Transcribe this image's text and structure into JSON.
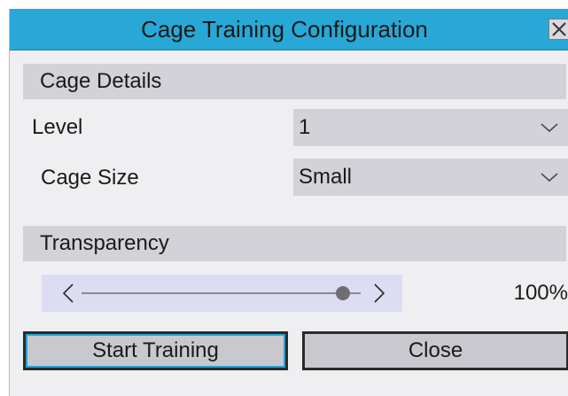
{
  "dialog": {
    "title": "Cage Training Configuration",
    "close_icon": "close-icon"
  },
  "cage_details": {
    "header": "Cage Details",
    "level": {
      "label": "Level",
      "value": "1",
      "icon": "chevron-down-icon"
    },
    "cage_size": {
      "label": "Cage Size",
      "value": "Small",
      "icon": "chevron-down-icon"
    }
  },
  "transparency": {
    "header": "Transparency",
    "value_text": "100%",
    "level_fraction": 1.0,
    "left_icon": "chevron-left-icon",
    "right_icon": "chevron-right-icon"
  },
  "buttons": {
    "start_label": "Start Training",
    "close_label": "Close"
  },
  "colors": {
    "titlebar": "#28a8d6",
    "dialog_bg": "#efeff2",
    "section_bg": "#d2d2d8",
    "slider_bg": "#dcdcf2",
    "focus_ring": "#26a2d0"
  }
}
